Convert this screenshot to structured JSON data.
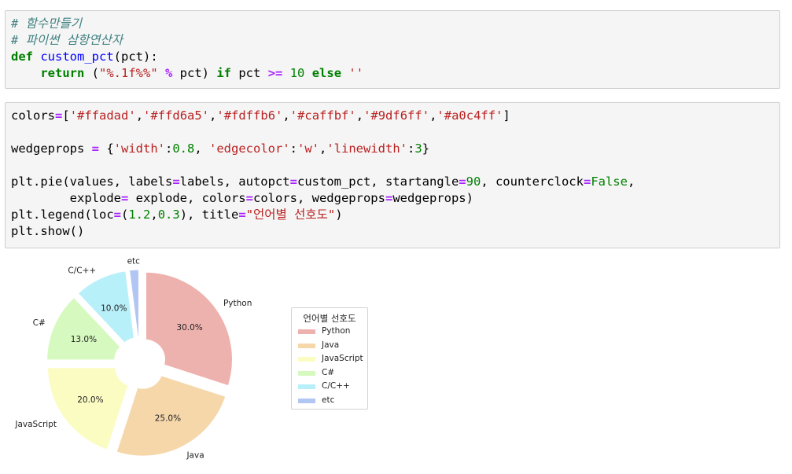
{
  "cell1": {
    "lines": [
      [
        {
          "t": "# 함수만들기",
          "c": "cm"
        }
      ],
      [
        {
          "t": "# 파이썬 삼항연산자",
          "c": "cm"
        }
      ],
      [
        {
          "t": "def",
          "c": "kw"
        },
        {
          "t": " ",
          "c": ""
        },
        {
          "t": "custom_pct",
          "c": "fn"
        },
        {
          "t": "(pct):",
          "c": ""
        }
      ],
      [
        {
          "t": "    ",
          "c": ""
        },
        {
          "t": "return",
          "c": "kw"
        },
        {
          "t": " (",
          "c": ""
        },
        {
          "t": "\"%.1f%%\"",
          "c": "st"
        },
        {
          "t": " ",
          "c": ""
        },
        {
          "t": "%",
          "c": "op"
        },
        {
          "t": " pct) ",
          "c": ""
        },
        {
          "t": "if",
          "c": "kw"
        },
        {
          "t": " pct ",
          "c": ""
        },
        {
          "t": ">=",
          "c": "op"
        },
        {
          "t": " ",
          "c": ""
        },
        {
          "t": "10",
          "c": "nm"
        },
        {
          "t": " ",
          "c": ""
        },
        {
          "t": "else",
          "c": "kw"
        },
        {
          "t": " ",
          "c": ""
        },
        {
          "t": "''",
          "c": "st"
        }
      ]
    ]
  },
  "cell2": {
    "lines": [
      [
        {
          "t": "colors",
          "c": ""
        },
        {
          "t": "=",
          "c": "op"
        },
        {
          "t": "[",
          "c": ""
        },
        {
          "t": "'#ffadad'",
          "c": "st"
        },
        {
          "t": ",",
          "c": ""
        },
        {
          "t": "'#ffd6a5'",
          "c": "st"
        },
        {
          "t": ",",
          "c": ""
        },
        {
          "t": "'#fdffb6'",
          "c": "st"
        },
        {
          "t": ",",
          "c": ""
        },
        {
          "t": "'#caffbf'",
          "c": "st"
        },
        {
          "t": ",",
          "c": ""
        },
        {
          "t": "'#9df6ff'",
          "c": "st"
        },
        {
          "t": ",",
          "c": ""
        },
        {
          "t": "'#a0c4ff'",
          "c": "st"
        },
        {
          "t": "]",
          "c": ""
        }
      ],
      [
        {
          "t": "",
          "c": ""
        }
      ],
      [
        {
          "t": "wedgeprops ",
          "c": ""
        },
        {
          "t": "=",
          "c": "op"
        },
        {
          "t": " {",
          "c": ""
        },
        {
          "t": "'width'",
          "c": "st"
        },
        {
          "t": ":",
          "c": ""
        },
        {
          "t": "0.8",
          "c": "nm"
        },
        {
          "t": ", ",
          "c": ""
        },
        {
          "t": "'edgecolor'",
          "c": "st"
        },
        {
          "t": ":",
          "c": ""
        },
        {
          "t": "'w'",
          "c": "st"
        },
        {
          "t": ",",
          "c": ""
        },
        {
          "t": "'linewidth'",
          "c": "st"
        },
        {
          "t": ":",
          "c": ""
        },
        {
          "t": "3",
          "c": "nm"
        },
        {
          "t": "}",
          "c": ""
        }
      ],
      [
        {
          "t": "",
          "c": ""
        }
      ],
      [
        {
          "t": "plt.pie(values, labels",
          "c": ""
        },
        {
          "t": "=",
          "c": "op"
        },
        {
          "t": "labels, autopct",
          "c": ""
        },
        {
          "t": "=",
          "c": "op"
        },
        {
          "t": "custom_pct, startangle",
          "c": ""
        },
        {
          "t": "=",
          "c": "op"
        },
        {
          "t": "90",
          "c": "nm"
        },
        {
          "t": ", counterclock",
          "c": ""
        },
        {
          "t": "=",
          "c": "op"
        },
        {
          "t": "False",
          "c": "bi"
        },
        {
          "t": ",",
          "c": ""
        }
      ],
      [
        {
          "t": "        explode",
          "c": ""
        },
        {
          "t": "=",
          "c": "op"
        },
        {
          "t": " explode, colors",
          "c": ""
        },
        {
          "t": "=",
          "c": "op"
        },
        {
          "t": "colors, wedgeprops",
          "c": ""
        },
        {
          "t": "=",
          "c": "op"
        },
        {
          "t": "wedgeprops)",
          "c": ""
        }
      ],
      [
        {
          "t": "plt.legend(loc",
          "c": ""
        },
        {
          "t": "=",
          "c": "op"
        },
        {
          "t": "(",
          "c": ""
        },
        {
          "t": "1.2",
          "c": "nm"
        },
        {
          "t": ",",
          "c": ""
        },
        {
          "t": "0.3",
          "c": "nm"
        },
        {
          "t": "), title",
          "c": ""
        },
        {
          "t": "=",
          "c": "op"
        },
        {
          "t": "\"언어별 선호도\"",
          "c": "st"
        },
        {
          "t": ")",
          "c": ""
        }
      ],
      [
        {
          "t": "plt.show()",
          "c": ""
        }
      ]
    ]
  },
  "chart_data": {
    "type": "pie",
    "categories": [
      "Python",
      "Java",
      "JavaScript",
      "C#",
      "C/C++",
      "etc"
    ],
    "values": [
      30,
      25,
      20,
      13,
      10,
      2
    ],
    "pct_labels": [
      "30.0%",
      "25.0%",
      "20.0%",
      "13.0%",
      "10.0%",
      ""
    ],
    "colors": [
      "#ffadad",
      "#ffd6a5",
      "#fdffb6",
      "#caffbf",
      "#9df6ff",
      "#a0c4ff"
    ],
    "display_colors": [
      "#eeb2ae",
      "#f5d7aa",
      "#fbfcc2",
      "#d6f9bf",
      "#b8f0fa",
      "#b2c6f3"
    ],
    "startangle": 90,
    "counterclock": false,
    "wedge_width": 0.8,
    "legend_title": "언어별 선호도",
    "legend_placement": "right"
  }
}
